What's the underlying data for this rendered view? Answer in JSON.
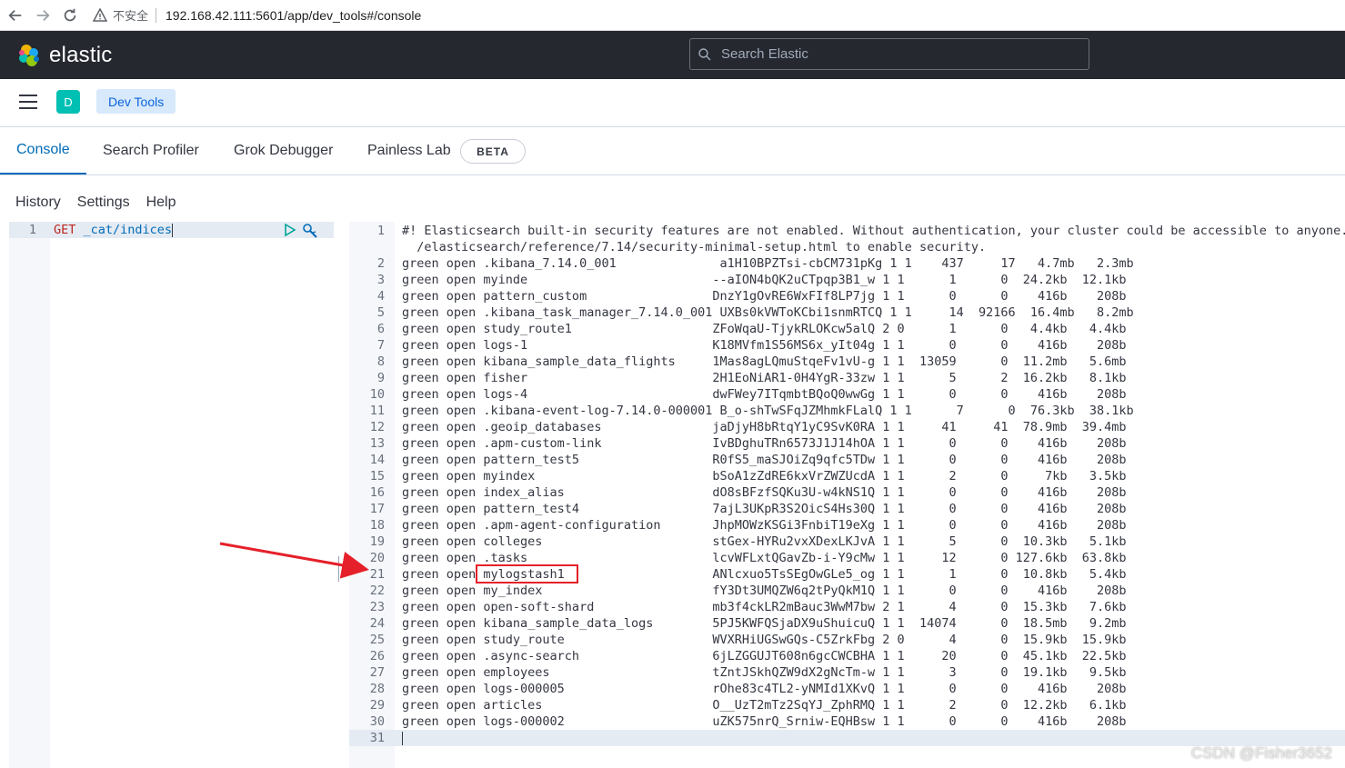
{
  "browser": {
    "security_label": "不安全",
    "url": "192.168.42.111:5601/app/dev_tools#/console"
  },
  "header": {
    "logo_text": "elastic",
    "search_placeholder": "Search Elastic"
  },
  "breadcrumb": {
    "space_initial": "D",
    "current": "Dev Tools"
  },
  "tabs": [
    {
      "label": "Console"
    },
    {
      "label": "Search Profiler"
    },
    {
      "label": "Grok Debugger"
    },
    {
      "label": "Painless Lab"
    }
  ],
  "beta_badge": "BETA",
  "console_menu": [
    "History",
    "Settings",
    "Help"
  ],
  "request": {
    "line_number": "1",
    "verb": "GET",
    "path": "_cat/indices"
  },
  "response_lines": [
    {
      "n": "1",
      "t": "#! Elasticsearch built-in security features are not enabled. Without authentication, your cluster could be accessible to anyone. See https://www.elastic.co/guide/en"
    },
    {
      "n": "",
      "t": "  /elasticsearch/reference/7.14/security-minimal-setup.html to enable security."
    },
    {
      "n": "2",
      "t": "green open .kibana_7.14.0_001              a1H10BPZTsi-cbCM731pKg 1 1    437     17   4.7mb   2.3mb"
    },
    {
      "n": "3",
      "t": "green open myinde                         --aION4bQK2uCTpqp3B1_w 1 1      1      0  24.2kb  12.1kb"
    },
    {
      "n": "4",
      "t": "green open pattern_custom                 DnzY1gOvRE6WxFIf8LP7jg 1 1      0      0    416b    208b"
    },
    {
      "n": "5",
      "t": "green open .kibana_task_manager_7.14.0_001 UXBs0kVWToKCbi1snmRTCQ 1 1     14  92166  16.4mb   8.2mb"
    },
    {
      "n": "6",
      "t": "green open study_route1                   ZFoWqaU-TjykRLOKcw5alQ 2 0      1      0   4.4kb   4.4kb"
    },
    {
      "n": "7",
      "t": "green open logs-1                         K18MVfm1S56MS6x_yIt04g 1 1      0      0    416b    208b"
    },
    {
      "n": "8",
      "t": "green open kibana_sample_data_flights     1Mas8agLQmuStqeFv1vU-g 1 1  13059      0  11.2mb   5.6mb"
    },
    {
      "n": "9",
      "t": "green open fisher                         2H1EoNiAR1-0H4YgR-33zw 1 1      5      2  16.2kb   8.1kb"
    },
    {
      "n": "10",
      "t": "green open logs-4                         dwFWey7ITqmbtBQoQ0wwGg 1 1      0      0    416b    208b"
    },
    {
      "n": "11",
      "t": "green open .kibana-event-log-7.14.0-000001 B_o-shTwSFqJZMhmkFLalQ 1 1      7      0  76.3kb  38.1kb"
    },
    {
      "n": "12",
      "t": "green open .geoip_databases               jaDjyH8bRtqY1yC9SvK0RA 1 1     41     41  78.9mb  39.4mb"
    },
    {
      "n": "13",
      "t": "green open .apm-custom-link               IvBDghuTRn6573J1J14hOA 1 1      0      0    416b    208b"
    },
    {
      "n": "14",
      "t": "green open pattern_test5                  R0fS5_maSJOiZq9qfc5TDw 1 1      0      0    416b    208b"
    },
    {
      "n": "15",
      "t": "green open myindex                        bSoA1zZdRE6kxVrZWZUcdA 1 1      2      0     7kb   3.5kb"
    },
    {
      "n": "16",
      "t": "green open index_alias                    dO8sBFzfSQKu3U-w4kNS1Q 1 1      0      0    416b    208b"
    },
    {
      "n": "17",
      "t": "green open pattern_test4                  7ajL3UKpR3S2OicS4Hs30Q 1 1      0      0    416b    208b"
    },
    {
      "n": "18",
      "t": "green open .apm-agent-configuration       JhpMOWzKSGi3FnbiT19eXg 1 1      0      0    416b    208b"
    },
    {
      "n": "19",
      "t": "green open colleges                       stGex-HYRu2vxXDexLKJvA 1 1      5      0  10.3kb   5.1kb"
    },
    {
      "n": "20",
      "t": "green open .tasks                         lcvWFLxtQGavZb-i-Y9cMw 1 1     12      0 127.6kb  63.8kb"
    },
    {
      "n": "21",
      "t": "green open mylogstash1                    ANlcxuo5TsSEgOwGLe5_og 1 1      1      0  10.8kb   5.4kb"
    },
    {
      "n": "22",
      "t": "green open my_index                       fY3Dt3UMQZW6q2tPyQkM1Q 1 1      0      0    416b    208b"
    },
    {
      "n": "23",
      "t": "green open open-soft-shard                mb3f4ckLR2mBauc3WwM7bw 2 1      4      0  15.3kb   7.6kb"
    },
    {
      "n": "24",
      "t": "green open kibana_sample_data_logs        5PJ5KWFQSjaDX9uShuicuQ 1 1  14074      0  18.5mb   9.2mb"
    },
    {
      "n": "25",
      "t": "green open study_route                    WVXRHiUGSwGQs-C5ZrkFbg 2 0      4      0  15.9kb  15.9kb"
    },
    {
      "n": "26",
      "t": "green open .async-search                  6jLZGGUJT608n6gcCWCBHA 1 1     20      0  45.1kb  22.5kb"
    },
    {
      "n": "27",
      "t": "green open employees                      tZntJSkhQZW9dX2gNcTm-w 1 1      3      0  19.1kb   9.5kb"
    },
    {
      "n": "28",
      "t": "green open logs-000005                    rOhe83c4TL2-yNMId1XKvQ 1 1      0      0    416b    208b"
    },
    {
      "n": "29",
      "t": "green open articles                       O__UzT2mTz2SqYJ_ZphRMQ 1 1      2      0  12.2kb   6.1kb"
    },
    {
      "n": "30",
      "t": "green open logs-000002                    uZK575nrQ_Srniw-EQHBsw 1 1      0      0    416b    208b"
    },
    {
      "n": "31",
      "t": ""
    }
  ],
  "watermark": "CSDN @Fisher3652",
  "colors": {
    "header_bg": "#25282f",
    "accent": "#006bb8",
    "highlight_box": "#e5202a",
    "space_badge": "#00bfb3"
  }
}
